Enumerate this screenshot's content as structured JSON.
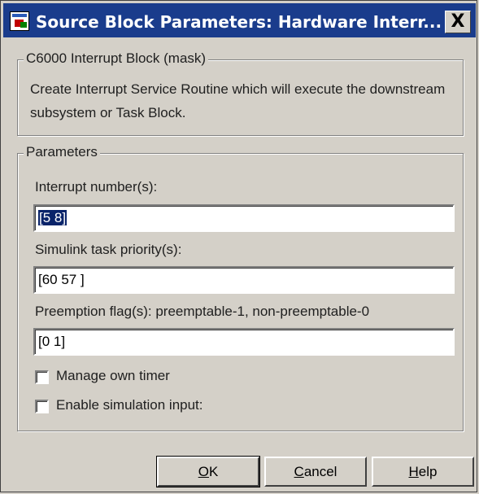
{
  "window": {
    "title": "Source Block Parameters: Hardware Interr...",
    "close_label": "X"
  },
  "mask_group": {
    "legend": "C6000 Interrupt Block (mask)",
    "description": "Create Interrupt Service Routine which will execute the downstream subsystem or Task Block."
  },
  "parameters": {
    "legend": "Parameters",
    "interrupt_numbers": {
      "label": "Interrupt number(s):",
      "value": "[5 8]"
    },
    "task_priority": {
      "label": "Simulink task priority(s):",
      "value": "[60 57 ]"
    },
    "preemption_flags": {
      "label": "Preemption flag(s): preemptable-1, non-preemptable-0",
      "value": "[0 1]"
    },
    "manage_own_timer": {
      "label": "Manage own timer",
      "checked": false
    },
    "enable_simulation_input": {
      "label": "Enable simulation input:",
      "checked": false
    }
  },
  "buttons": {
    "ok": {
      "mnemonic": "O",
      "rest": "K"
    },
    "cancel": {
      "mnemonic": "C",
      "rest": "ancel"
    },
    "help": {
      "mnemonic": "H",
      "rest": "elp"
    }
  }
}
